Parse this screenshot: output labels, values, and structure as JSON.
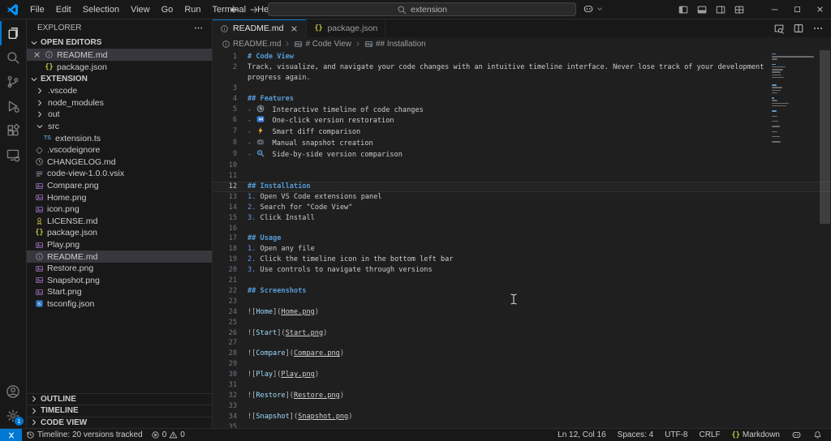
{
  "window": {
    "menus": [
      "File",
      "Edit",
      "Selection",
      "View",
      "Go",
      "Run",
      "Terminal",
      "Help"
    ],
    "command_center": {
      "value": "extension"
    }
  },
  "activity_bar": {
    "items": [
      {
        "id": "explorer",
        "icon": "files-icon",
        "active": true
      },
      {
        "id": "search",
        "icon": "search-icon",
        "active": false
      },
      {
        "id": "source-control",
        "icon": "source-control-icon",
        "active": false
      },
      {
        "id": "run-and-debug",
        "icon": "debug-icon",
        "active": false
      },
      {
        "id": "extensions",
        "icon": "extensions-icon",
        "active": false
      },
      {
        "id": "remote-explorer",
        "icon": "remote-explorer-icon",
        "active": false
      }
    ],
    "bottom": [
      {
        "id": "accounts",
        "icon": "account-icon"
      },
      {
        "id": "manage",
        "icon": "gear-icon",
        "badge": "1"
      }
    ]
  },
  "sidebar": {
    "title": "EXPLORER",
    "open_editors": {
      "label": "OPEN EDITORS",
      "items": [
        {
          "label": "README.md",
          "icon": "info",
          "active": true,
          "closable": true
        },
        {
          "label": "package.json",
          "icon": "json",
          "active": false,
          "closable": false
        }
      ]
    },
    "workspace": {
      "label": "EXTENSION",
      "tree": [
        {
          "label": ".vscode",
          "kind": "folder",
          "depth": 0
        },
        {
          "label": "node_modules",
          "kind": "folder",
          "depth": 0
        },
        {
          "label": "out",
          "kind": "folder",
          "depth": 0
        },
        {
          "label": "src",
          "kind": "folder",
          "expanded": true,
          "depth": 0
        },
        {
          "label": "extension.ts",
          "kind": "file",
          "icon": "ts",
          "depth": 1
        },
        {
          "label": ".vscodeignore",
          "kind": "file",
          "icon": "ignore",
          "depth": 0
        },
        {
          "label": "CHANGELOG.md",
          "kind": "file",
          "icon": "clock",
          "depth": 0
        },
        {
          "label": "code-view-1.0.0.vsix",
          "kind": "file",
          "icon": "vsix",
          "depth": 0
        },
        {
          "label": "Compare.png",
          "kind": "file",
          "icon": "image",
          "depth": 0
        },
        {
          "label": "Home.png",
          "kind": "file",
          "icon": "image",
          "depth": 0
        },
        {
          "label": "icon.png",
          "kind": "file",
          "icon": "image",
          "depth": 0
        },
        {
          "label": "LICENSE.md",
          "kind": "file",
          "icon": "license",
          "depth": 0
        },
        {
          "label": "package.json",
          "kind": "file",
          "icon": "json",
          "depth": 0
        },
        {
          "label": "Play.png",
          "kind": "file",
          "icon": "image",
          "depth": 0
        },
        {
          "label": "README.md",
          "kind": "file",
          "icon": "info",
          "selected": true,
          "depth": 0
        },
        {
          "label": "Restore.png",
          "kind": "file",
          "icon": "image",
          "depth": 0
        },
        {
          "label": "Snapshot.png",
          "kind": "file",
          "icon": "image",
          "depth": 0
        },
        {
          "label": "Start.png",
          "kind": "file",
          "icon": "image",
          "depth": 0
        },
        {
          "label": "tsconfig.json",
          "kind": "file",
          "icon": "tsconfig",
          "depth": 0
        }
      ]
    },
    "collapsed_sections": [
      "OUTLINE",
      "TIMELINE",
      "CODE VIEW"
    ]
  },
  "editor": {
    "tabs": [
      {
        "label": "README.md",
        "icon": "info",
        "active": true
      },
      {
        "label": "package.json",
        "icon": "json",
        "active": false
      }
    ],
    "breadcrumbs": [
      {
        "label": "README.md",
        "icon": "info"
      },
      {
        "label": "# Code View",
        "icon": "markdown"
      },
      {
        "label": "## Installation",
        "icon": "markdown"
      }
    ],
    "current_line": 12,
    "lines": [
      {
        "n": 1,
        "t": "h",
        "text": "# Code View"
      },
      {
        "n": 2,
        "t": "p",
        "text": "Track, visualize, and navigate your code changes with an intuitive timeline interface. Never lose track of your development progress again."
      },
      {
        "n": 3,
        "t": "blank"
      },
      {
        "n": 4,
        "t": "h",
        "text": "## Features"
      },
      {
        "n": 5,
        "t": "li",
        "icon": "clock-emoji",
        "text": "Interactive timeline of code changes"
      },
      {
        "n": 6,
        "t": "li",
        "icon": "rewind-emoji",
        "text": "One-click version restoration"
      },
      {
        "n": 7,
        "t": "li",
        "icon": "zap-emoji",
        "text": "Smart diff comparison"
      },
      {
        "n": 8,
        "t": "li",
        "icon": "camera-emoji",
        "text": "Manual snapshot creation"
      },
      {
        "n": 9,
        "t": "li",
        "icon": "magnifier-emoji",
        "text": "Side-by-side version comparison"
      },
      {
        "n": 10,
        "t": "blank"
      },
      {
        "n": 11,
        "t": "blank"
      },
      {
        "n": 12,
        "t": "h",
        "text": "## Installation"
      },
      {
        "n": 13,
        "t": "ol",
        "marker": "1.",
        "text": "Open VS Code extensions panel"
      },
      {
        "n": 14,
        "t": "ol",
        "marker": "2.",
        "text": "Search for \"Code View\""
      },
      {
        "n": 15,
        "t": "ol",
        "marker": "3.",
        "text": "Click Install"
      },
      {
        "n": 16,
        "t": "blank"
      },
      {
        "n": 17,
        "t": "h",
        "text": "## Usage"
      },
      {
        "n": 18,
        "t": "ol",
        "marker": "1.",
        "text": "Open any file"
      },
      {
        "n": 19,
        "t": "ol",
        "marker": "2.",
        "text": "Click the timeline icon in the bottom left bar"
      },
      {
        "n": 20,
        "t": "ol",
        "marker": "3.",
        "text": "Use controls to navigate through versions"
      },
      {
        "n": 21,
        "t": "blank"
      },
      {
        "n": 22,
        "t": "h",
        "text": "## Screenshots"
      },
      {
        "n": 23,
        "t": "blank"
      },
      {
        "n": 24,
        "t": "img",
        "label": "Home",
        "path": "Home.png"
      },
      {
        "n": 25,
        "t": "blank"
      },
      {
        "n": 26,
        "t": "img",
        "label": "Start",
        "path": "Start.png"
      },
      {
        "n": 27,
        "t": "blank"
      },
      {
        "n": 28,
        "t": "img",
        "label": "Compare",
        "path": "Compare.png"
      },
      {
        "n": 29,
        "t": "blank"
      },
      {
        "n": 30,
        "t": "img",
        "label": "Play",
        "path": "Play.png"
      },
      {
        "n": 31,
        "t": "blank"
      },
      {
        "n": 32,
        "t": "img",
        "label": "Restore",
        "path": "Restore.png"
      },
      {
        "n": 33,
        "t": "blank"
      },
      {
        "n": 34,
        "t": "img",
        "label": "Snapshot",
        "path": "Snapshot.png"
      },
      {
        "n": 35,
        "t": "blank"
      }
    ]
  },
  "status_bar": {
    "timeline": "Timeline: 20 versions tracked",
    "errors": "0",
    "warnings": "0",
    "cursor_position": "Ln 12, Col 16",
    "indentation": "Spaces: 4",
    "encoding": "UTF-8",
    "eol": "CRLF",
    "language": "Markdown"
  },
  "colors": {
    "accent": "#0078d4",
    "heading": "#569cd6",
    "selection_bg": "#37373d",
    "editor_bg": "#1f1f1f",
    "chrome_bg": "#181818"
  }
}
